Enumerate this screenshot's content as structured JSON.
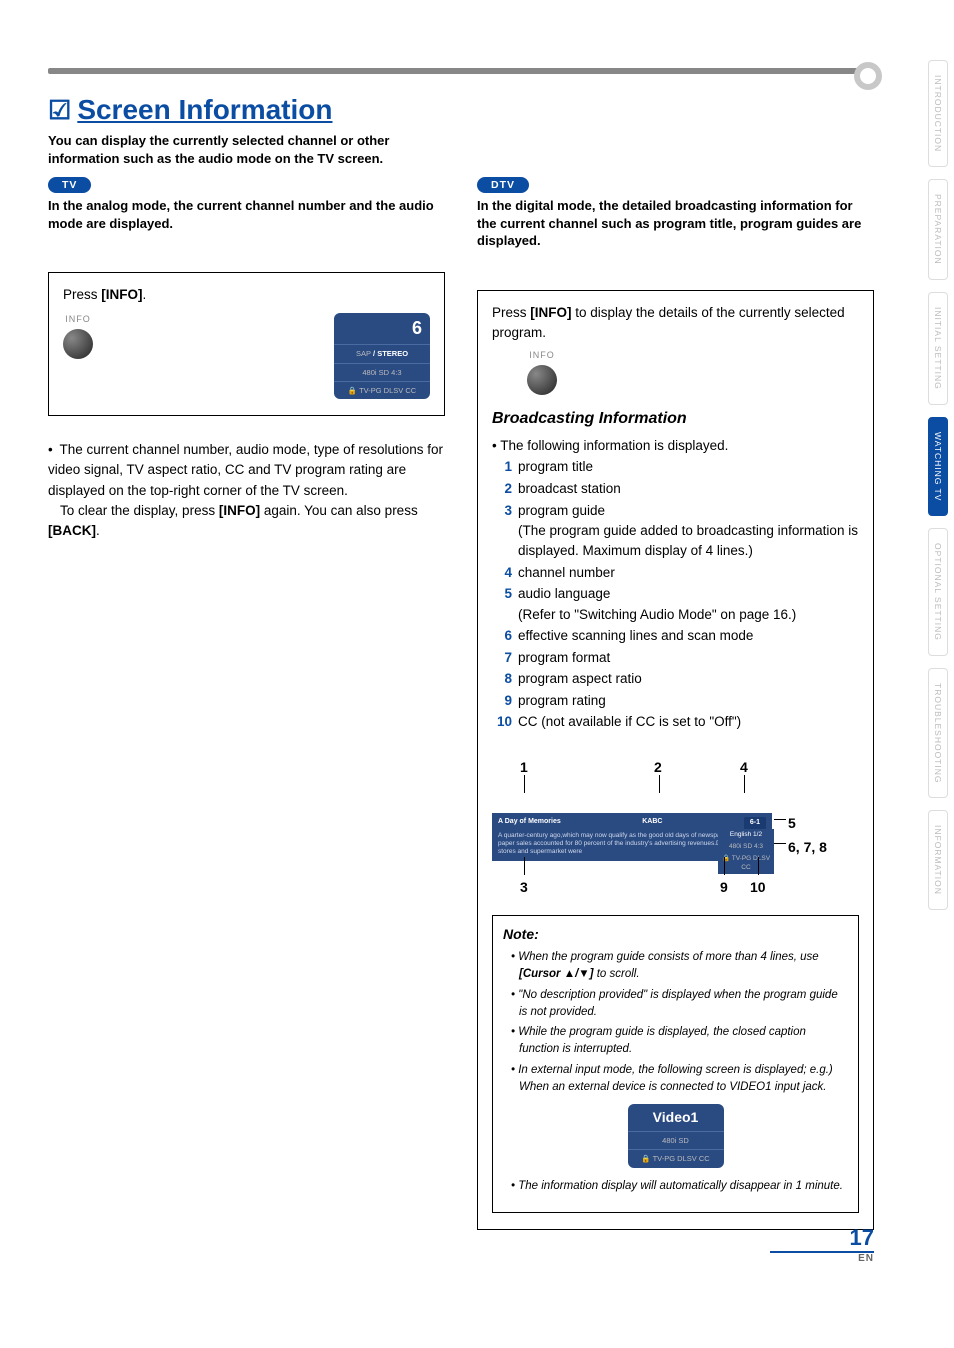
{
  "page": {
    "title": "Screen Information",
    "subtitle": "You can display the currently selected channel or other information such as the audio mode on the TV screen.",
    "tv_tag": "TV",
    "dtv_tag": "DTV",
    "tv_desc": "In the analog mode, the current channel number and the audio mode are displayed.",
    "dtv_desc": "In the digital mode, the detailed broadcasting information for the current channel such as program title, program guides are displayed.",
    "page_number": "17",
    "page_lang": "EN"
  },
  "left": {
    "press_prefix": "Press ",
    "press_button": "[INFO]",
    "press_suffix": ".",
    "info_label": "INFO",
    "ch": "6",
    "sap": "SAP",
    "stereo": " / STEREO",
    "res_line": "480i   SD   4:3",
    "rating_line": "🔒 TV-PG DLSV  CC",
    "bullet": "The current channel number, audio mode, type of resolutions for video signal, TV aspect ratio, CC and TV program rating are displayed on the top-right corner of the TV screen.",
    "clear_prefix": "To clear the display, press ",
    "clear_btn1": "[INFO]",
    "clear_mid": " again. You can also press ",
    "clear_btn2": "[BACK]",
    "clear_suffix": "."
  },
  "right": {
    "press_prefix": "Press ",
    "press_button": "[INFO]",
    "press_suffix": " to display the details of the currently selected program.",
    "info_label": "INFO",
    "bi_heading": "Broadcasting Information",
    "intro": "The following information is displayed.",
    "items": {
      "1": "program title",
      "2": "broadcast station",
      "3": "program guide",
      "3note": "(The program guide added to broadcasting information is displayed. Maximum display of 4 lines.)",
      "4": "channel number",
      "5": "audio language",
      "5note": "(Refer to \"Switching Audio Mode\" on page 16.)",
      "6": "effective scanning lines and scan mode",
      "7": "program format",
      "8": "program aspect ratio",
      "9": "program rating",
      "10": "CC (not available if CC is set to \"Off\")"
    },
    "fig": {
      "l1": "1",
      "l2": "2",
      "l3": "3",
      "l4": "4",
      "l5": "5",
      "l678": "6, 7, 8",
      "l9": "9",
      "l10": "10",
      "title": "A Day of Memories",
      "station": "KABC",
      "ch": "6-1",
      "guide": "A quarter-century ago,which may now qualify as the good old days of newspapering,run-of-paper sales accounted for 80 percent of the industry's advertising revenues.Department stores and supermarket were",
      "audio": "English 1/2",
      "res": "480i  SD  4:3",
      "rating": "🔒 TV-PG DLSV  CC"
    },
    "note": {
      "title": "Note:",
      "n1a": "When the program guide consists of more than 4 lines, use ",
      "n1b": "[Cursor ▲/▼]",
      "n1c": " to scroll.",
      "n2": "\"No description provided\" is displayed when the program guide is not provided.",
      "n3": "While the program guide is displayed, the closed caption function is interrupted.",
      "n4": "In external input mode, the following screen is displayed; e.g.) When an external device is connected to VIDEO1 input jack.",
      "video_label": "Video1",
      "video_res": "480i   SD",
      "video_rating": "🔒 TV-PG DLSV  CC",
      "n5": "The information display will automatically disappear in 1 minute."
    }
  },
  "tabs": {
    "t1": "INTRODUCTION",
    "t2": "PREPARATION",
    "t3": "INITIAL SETTING",
    "t4": "WATCHING TV",
    "t5": "OPTIONAL SETTING",
    "t6": "TROUBLESHOOTING",
    "t7": "INFORMATION"
  }
}
